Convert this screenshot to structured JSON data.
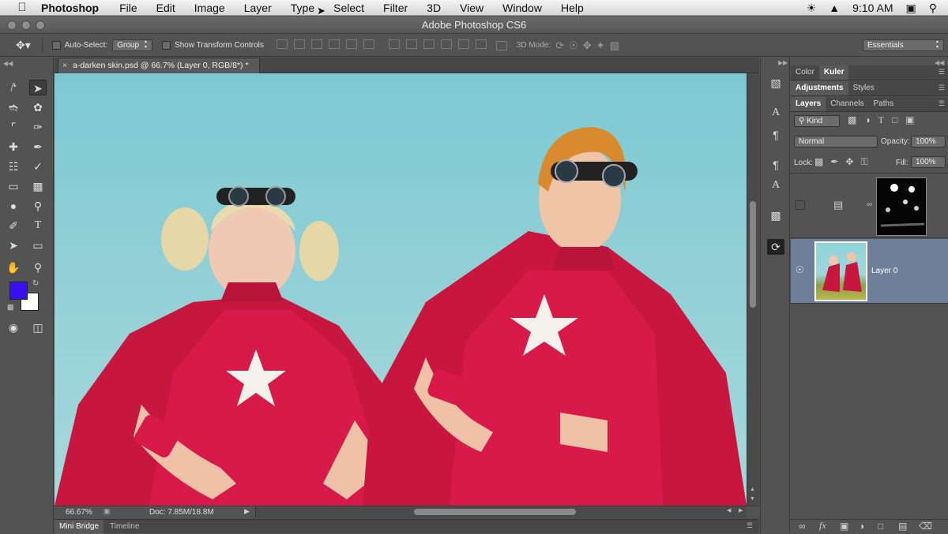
{
  "menubar": {
    "app_name": "Photoshop",
    "items": [
      "File",
      "Edit",
      "Image",
      "Layer",
      "Type",
      "Select",
      "Filter",
      "3D",
      "View",
      "Window",
      "Help"
    ],
    "clock": "9:10 AM"
  },
  "window": {
    "title": "Adobe Photoshop CS6"
  },
  "options_bar": {
    "auto_select_label": "Auto-Select:",
    "auto_select_value": "Group",
    "show_transform_label": "Show Transform Controls",
    "mode_3d_label": "3D Mode:",
    "workspace": "Essentials"
  },
  "document": {
    "tab_title": "a-darken skin.psd @ 66.7% (Layer 0, RGB/8*) *",
    "zoom": "66.67%",
    "doc_size": "Doc: 7.85M/18.8M"
  },
  "bottom_tabs": [
    "Mini Bridge",
    "Timeline"
  ],
  "colors": {
    "foreground": "#3b10f0",
    "background": "#ffffff"
  },
  "panels": {
    "group1_tabs": [
      "Color",
      "Kuler"
    ],
    "group2_tabs": [
      "Adjustments",
      "Styles"
    ],
    "group3_tabs": [
      "Layers",
      "Channels",
      "Paths"
    ],
    "kind_label": "Kind",
    "blend_mode": "Normal",
    "opacity_label": "Opacity:",
    "opacity_value": "100%",
    "lock_label": "Lock:",
    "fill_label": "Fill:",
    "fill_value": "100%",
    "layers": [
      {
        "name": "",
        "type": "adjustment-curves",
        "visible": false
      },
      {
        "name": "Layer 0",
        "type": "pixel",
        "visible": true,
        "selected": true
      }
    ]
  }
}
